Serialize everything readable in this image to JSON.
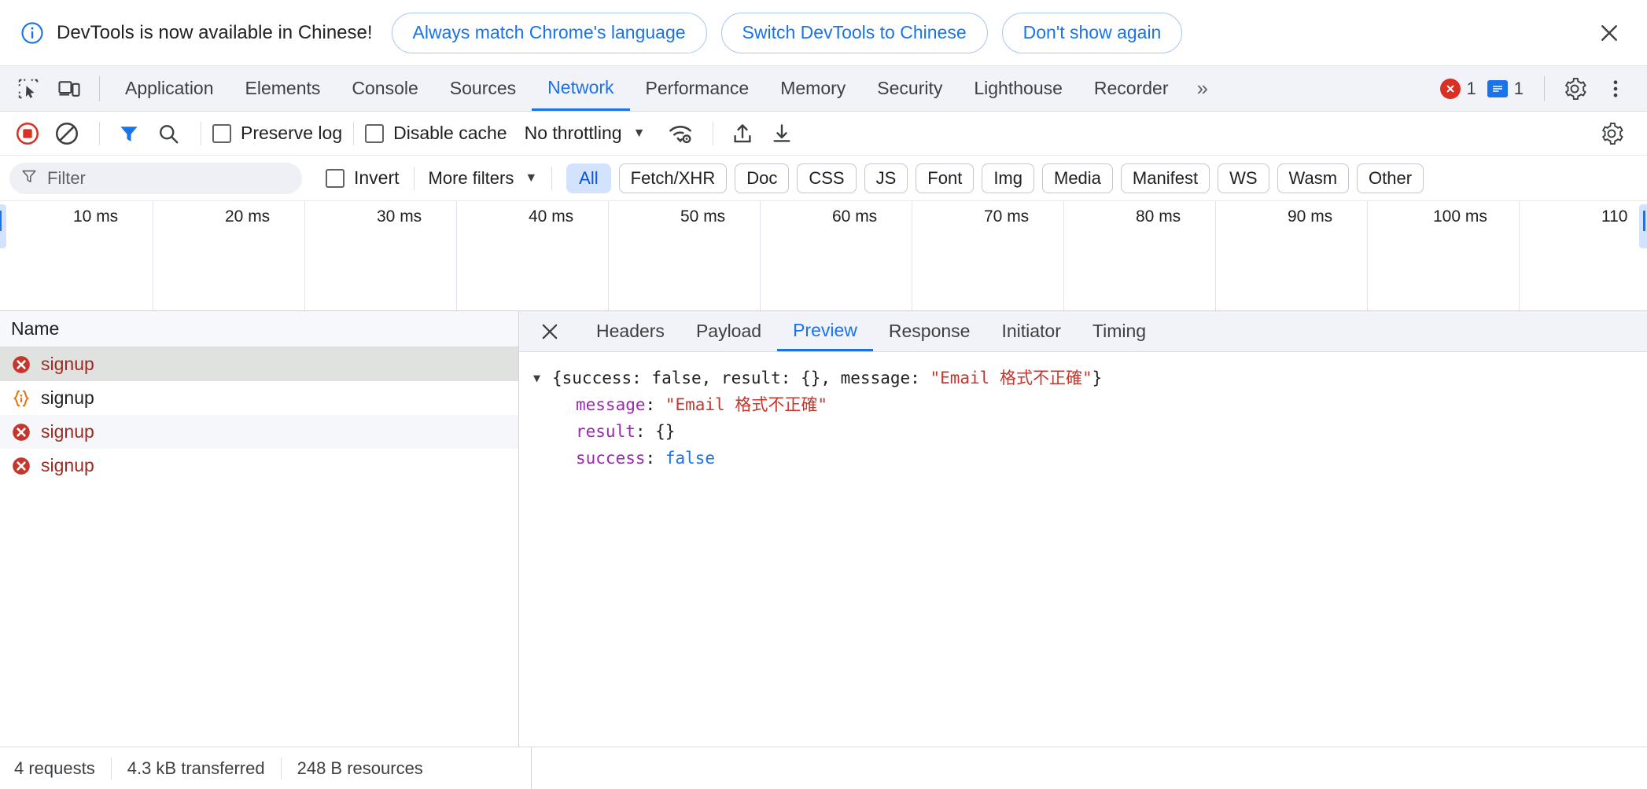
{
  "banner": {
    "icon": "info-icon",
    "text": "DevTools is now available in Chinese!",
    "buttons": [
      {
        "label": "Always match Chrome's language"
      },
      {
        "label": "Switch DevTools to Chinese"
      },
      {
        "label": "Don't show again"
      }
    ],
    "close_icon": "close-icon"
  },
  "tabbar": {
    "icons": [
      {
        "name": "inspect-element-icon"
      },
      {
        "name": "device-toolbar-icon"
      }
    ],
    "tabs": [
      {
        "label": "Application",
        "active": false
      },
      {
        "label": "Elements",
        "active": false
      },
      {
        "label": "Console",
        "active": false
      },
      {
        "label": "Sources",
        "active": false
      },
      {
        "label": "Network",
        "active": true
      },
      {
        "label": "Performance",
        "active": false
      },
      {
        "label": "Memory",
        "active": false
      },
      {
        "label": "Security",
        "active": false
      },
      {
        "label": "Lighthouse",
        "active": false
      },
      {
        "label": "Recorder",
        "active": false
      }
    ],
    "more_tabs": "»",
    "error_count": "1",
    "warning_count": "1",
    "settings_icon": "gear-icon",
    "menu_icon": "kebab-menu-icon",
    "error_color": "#d93025",
    "message_color": "#1a73e8"
  },
  "network_toolbar": {
    "record_label": "record-button",
    "clear_label": "clear-button",
    "filter_toggle": "filter-icon",
    "search": "search-icon",
    "preserve_log": {
      "label": "Preserve log",
      "checked": false
    },
    "disable_cache": {
      "label": "Disable cache",
      "checked": false
    },
    "throttling": {
      "value": "No throttling"
    },
    "network_conditions_icon": "wifi-settings-icon",
    "export_har_icon": "upload-icon",
    "import_har_icon": "download-icon",
    "settings_icon": "gear-icon",
    "record_active_color": "#d93025",
    "filter_active_color": "#1a73e8"
  },
  "filter_bar": {
    "placeholder": "Filter",
    "value": "",
    "invert": {
      "label": "Invert",
      "checked": false
    },
    "more_filters": "More filters",
    "chips": [
      {
        "label": "All",
        "active": true
      },
      {
        "label": "Fetch/XHR",
        "active": false
      },
      {
        "label": "Doc",
        "active": false
      },
      {
        "label": "CSS",
        "active": false
      },
      {
        "label": "JS",
        "active": false
      },
      {
        "label": "Font",
        "active": false
      },
      {
        "label": "Img",
        "active": false
      },
      {
        "label": "Media",
        "active": false
      },
      {
        "label": "Manifest",
        "active": false
      },
      {
        "label": "WS",
        "active": false
      },
      {
        "label": "Wasm",
        "active": false
      },
      {
        "label": "Other",
        "active": false
      }
    ],
    "active_chip_bg": "#d3e3fd",
    "active_chip_color": "#0b57d0"
  },
  "overview": {
    "ticks": [
      "10 ms",
      "20 ms",
      "30 ms",
      "40 ms",
      "50 ms",
      "60 ms",
      "70 ms",
      "80 ms",
      "90 ms",
      "100 ms",
      "110"
    ]
  },
  "request_list": {
    "column_header": "Name",
    "rows": [
      {
        "name": "signup",
        "icon": "error-icon",
        "error": true,
        "selected": true
      },
      {
        "name": "signup",
        "icon": "json-icon",
        "error": false,
        "selected": false
      },
      {
        "name": "signup",
        "icon": "error-icon",
        "error": true,
        "selected": false
      },
      {
        "name": "signup",
        "icon": "error-icon",
        "error": true,
        "selected": false
      }
    ]
  },
  "detail": {
    "close_icon": "close-icon",
    "tabs": [
      {
        "label": "Headers",
        "active": false
      },
      {
        "label": "Payload",
        "active": false
      },
      {
        "label": "Preview",
        "active": true
      },
      {
        "label": "Response",
        "active": false
      },
      {
        "label": "Initiator",
        "active": false
      },
      {
        "label": "Timing",
        "active": false
      }
    ],
    "preview": {
      "expanded": true,
      "summary": "{success: false, result: {}, message: \"Email 格式不正確\"}",
      "summary_parts": {
        "open": "{success: false, result: {}, message: ",
        "string": "\"Email 格式不正確\"",
        "close": "}"
      },
      "properties": [
        {
          "key": "message",
          "value": "\"Email 格式不正確\"",
          "type": "string"
        },
        {
          "key": "result",
          "value": "{}",
          "type": "object"
        },
        {
          "key": "success",
          "value": "false",
          "type": "boolean"
        }
      ],
      "key_color": "#9c27b0",
      "string_color": "#c5372c",
      "boolean_color": "#1a73e8"
    }
  },
  "status_bar": {
    "requests": "4 requests",
    "transferred": "4.3 kB transferred",
    "resources": "248 B resources"
  }
}
